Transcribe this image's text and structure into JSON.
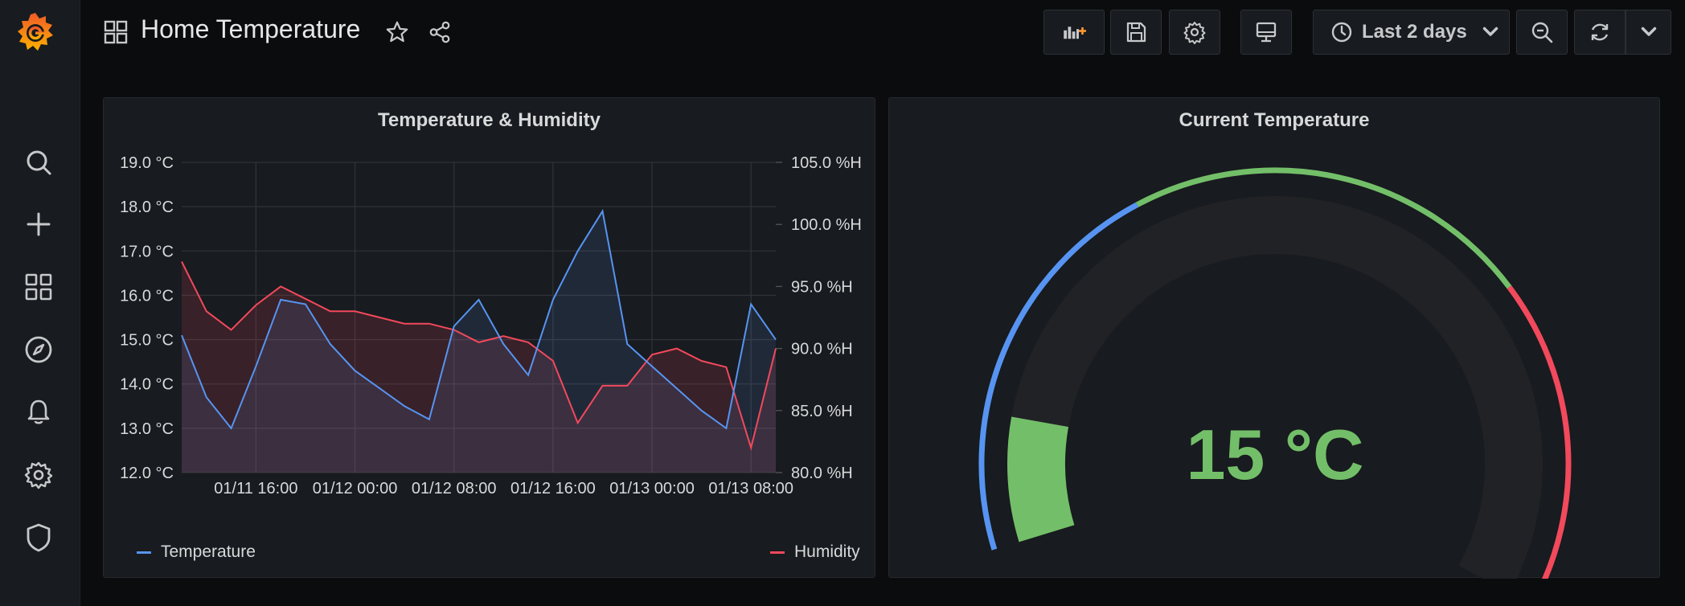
{
  "dashboard": {
    "title": "Home Temperature"
  },
  "toolbar": {
    "time_range": "Last 2 days"
  },
  "colors": {
    "temperature": "#5794f2",
    "humidity": "#f2495c",
    "green": "#73bf69"
  },
  "panels": {
    "graph": {
      "title": "Temperature & Humidity",
      "left_axis": [
        "19.0 °C",
        "18.0 °C",
        "17.0 °C",
        "16.0 °C",
        "15.0 °C",
        "14.0 °C",
        "13.0 °C",
        "12.0 °C"
      ],
      "right_axis": [
        "105.0 %H",
        "100.0 %H",
        "95.0 %H",
        "90.0 %H",
        "85.0 %H",
        "80.0 %H"
      ],
      "x_axis": [
        "01/11 16:00",
        "01/12 00:00",
        "01/12 08:00",
        "01/12 16:00",
        "01/13 00:00",
        "01/13 08:00"
      ],
      "legend": {
        "temperature": "Temperature",
        "humidity": "Humidity"
      }
    },
    "gauge": {
      "title": "Current Temperature",
      "value": "15 °C",
      "fraction": 0.12
    }
  },
  "chart_data": {
    "type": "line",
    "title": "Temperature & Humidity",
    "x": [
      "01/11 10:00",
      "01/11 12:00",
      "01/11 14:00",
      "01/11 16:00",
      "01/11 18:00",
      "01/11 20:00",
      "01/11 22:00",
      "01/12 00:00",
      "01/12 02:00",
      "01/12 04:00",
      "01/12 06:00",
      "01/12 08:00",
      "01/12 10:00",
      "01/12 12:00",
      "01/12 14:00",
      "01/12 16:00",
      "01/12 18:00",
      "01/12 20:00",
      "01/12 22:00",
      "01/13 00:00",
      "01/13 02:00",
      "01/13 04:00",
      "01/13 06:00",
      "01/13 08:00",
      "01/13 10:00"
    ],
    "series": [
      {
        "name": "Temperature",
        "axis": "left",
        "unit": "°C",
        "values": [
          15.1,
          13.7,
          13.0,
          14.4,
          15.9,
          15.8,
          14.9,
          14.3,
          13.9,
          13.5,
          13.2,
          15.3,
          15.9,
          14.9,
          14.2,
          15.9,
          17.0,
          17.9,
          14.9,
          14.4,
          13.9,
          13.4,
          13.0,
          15.8,
          15.0
        ]
      },
      {
        "name": "Humidity",
        "axis": "right",
        "unit": "%H",
        "values": [
          97.0,
          93.0,
          91.5,
          93.5,
          95.0,
          94.0,
          93.0,
          93.0,
          92.5,
          92.0,
          92.0,
          91.5,
          90.5,
          91.0,
          90.5,
          89.0,
          84.0,
          87.0,
          87.0,
          89.5,
          90.0,
          89.0,
          88.5,
          82.0,
          90.0
        ]
      }
    ],
    "ylim_left": [
      12,
      19
    ],
    "ylim_right": [
      80,
      105
    ],
    "grid": true,
    "legend": "bottom"
  }
}
